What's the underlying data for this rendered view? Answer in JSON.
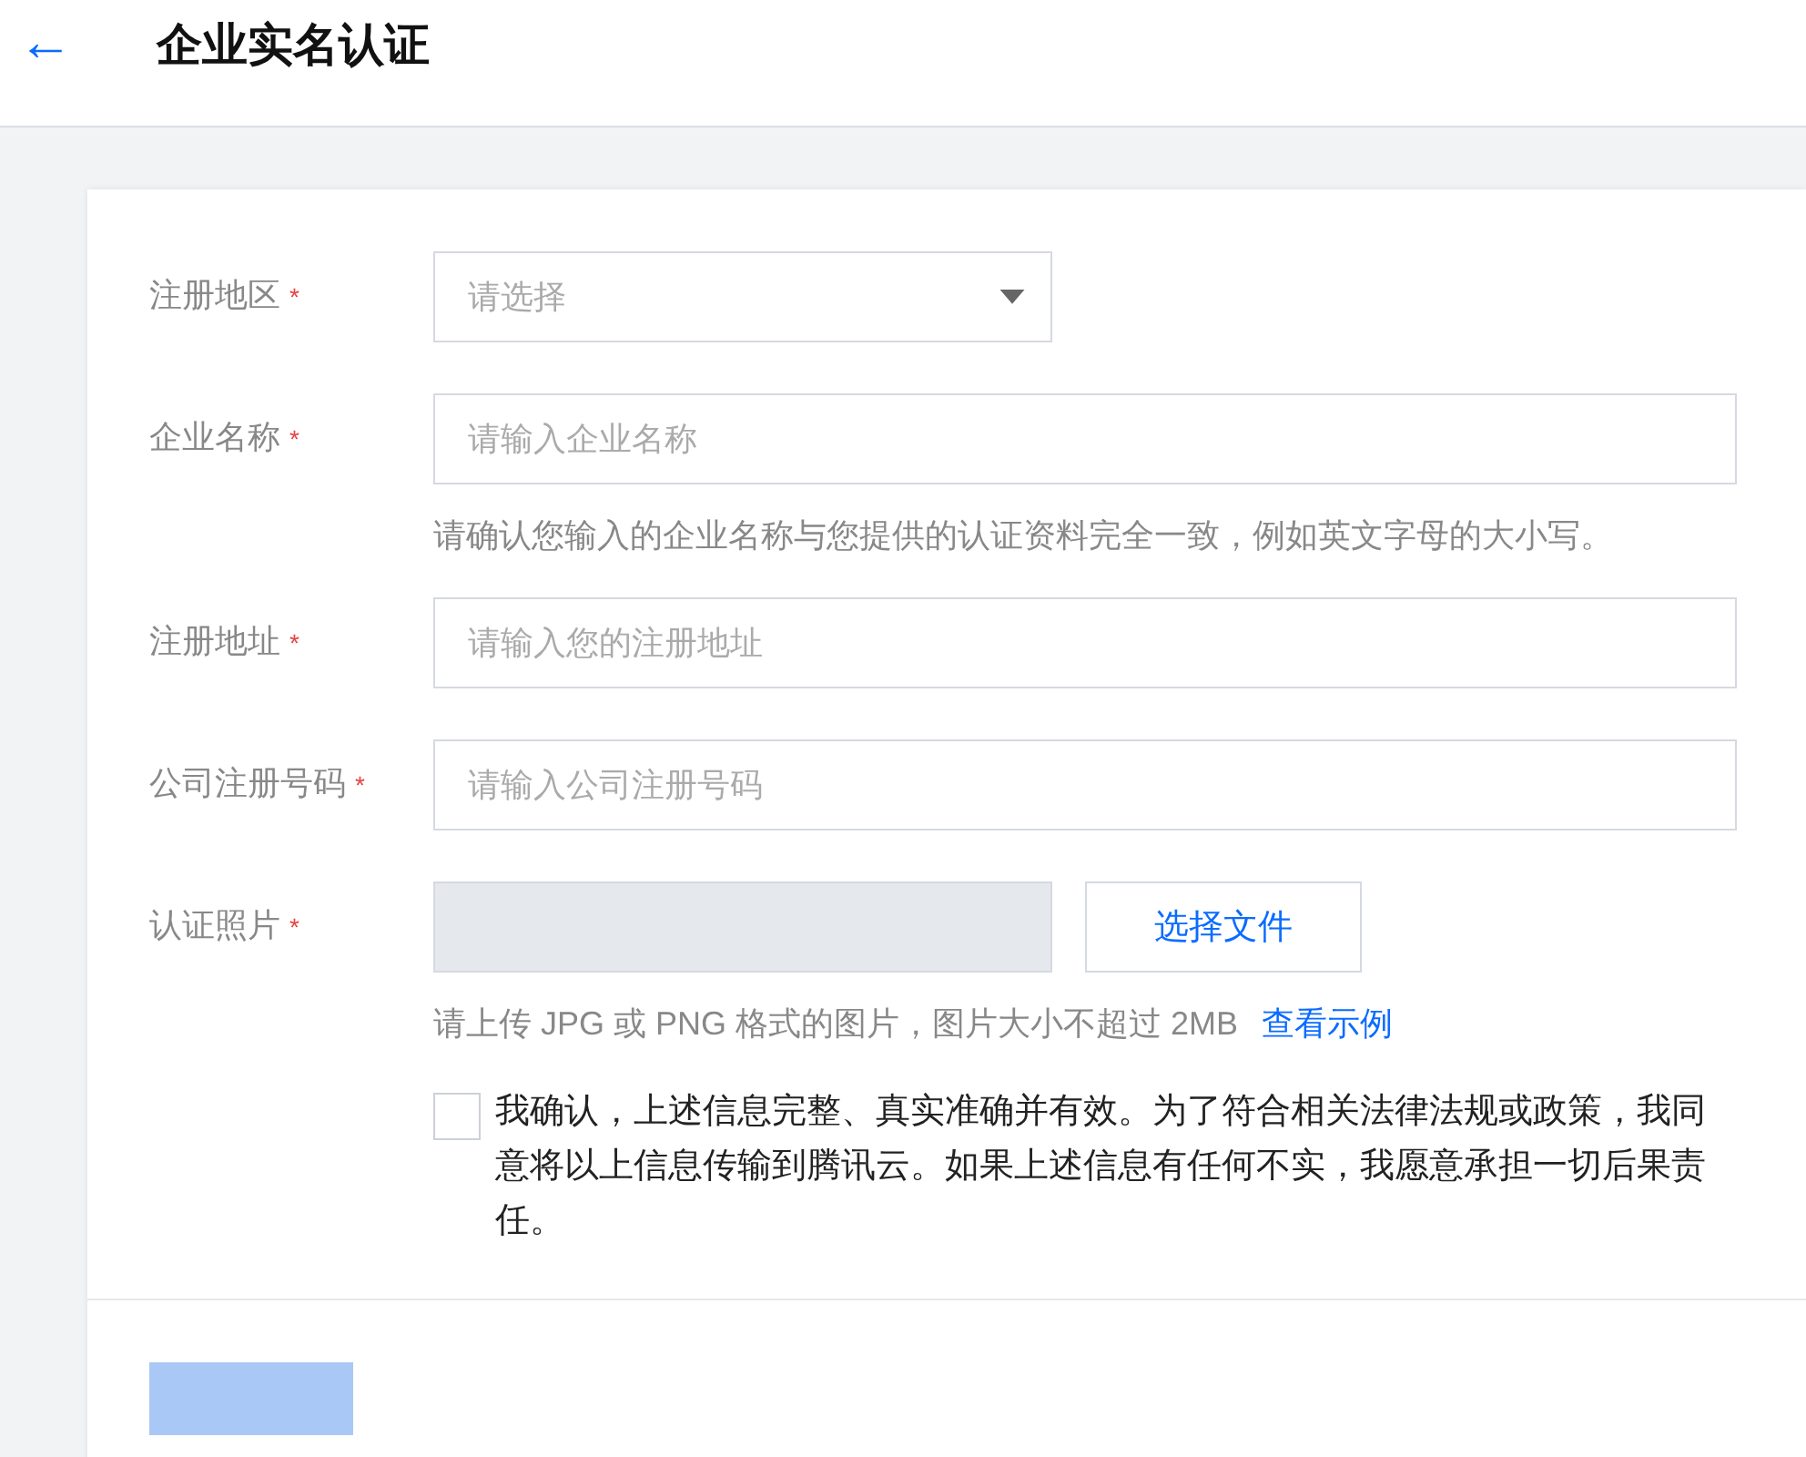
{
  "header": {
    "back": "←",
    "title": "企业实名认证"
  },
  "fields": [
    {
      "kind": "select",
      "label": "注册地区",
      "required_mark": "*",
      "placeholder": "请选择"
    },
    {
      "kind": "text",
      "label": "企业名称",
      "required_mark": "*",
      "placeholder": "请输入企业名称",
      "hint": "请确认您输入的企业名称与您提供的认证资料完全一致，例如英文字母的大小写。"
    },
    {
      "kind": "text",
      "label": "注册地址",
      "required_mark": "*",
      "placeholder": "请输入您的注册地址"
    },
    {
      "kind": "text",
      "label": "公司注册号码",
      "required_mark": "*",
      "placeholder": "请输入公司注册号码"
    },
    {
      "kind": "file",
      "label": "认证照片",
      "required_mark": "*",
      "button": "选择文件",
      "hint": "请上传 JPG 或 PNG 格式的图片，图片大小不超过 2MB",
      "link": "查看示例"
    }
  ],
  "agreement": {
    "checked": false,
    "text": "我确认，上述信息完整、真实准确并有效。为了符合相关法律法规或政策，我同意将以上信息传输到腾讯云。如果上述信息有任何不实，我愿意承担一切后果责任。"
  },
  "submit": {
    "disabled": true
  }
}
